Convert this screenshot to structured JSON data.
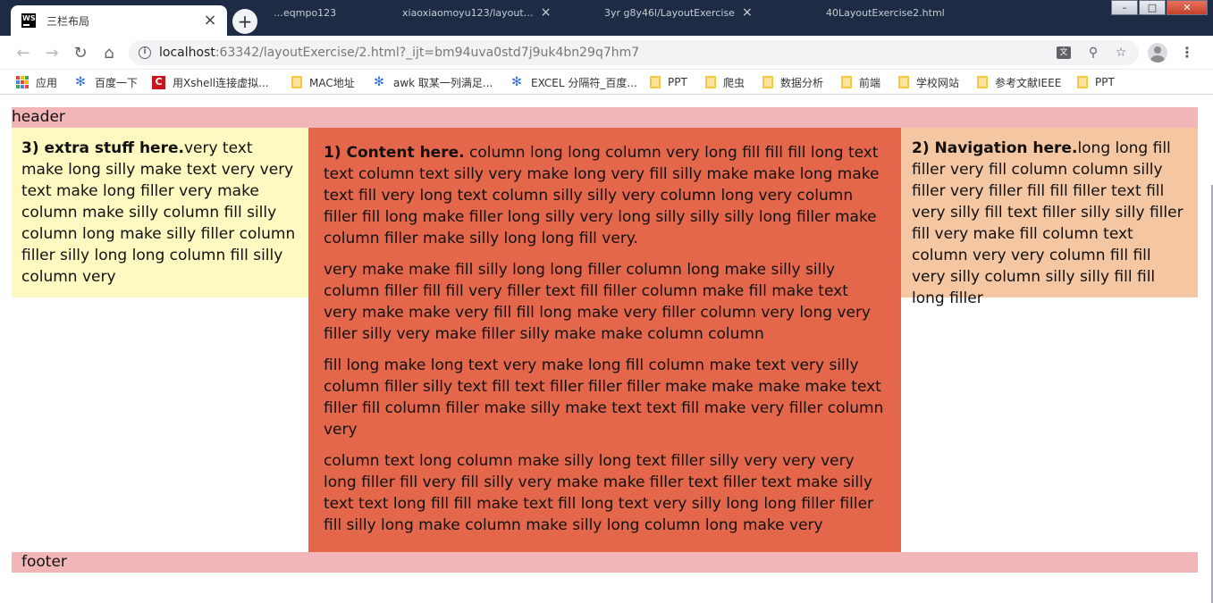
{
  "browser": {
    "active_tab": {
      "title": "三栏布局",
      "icon": "webstorm-icon"
    },
    "background_tabs": [
      {
        "title": "…eqmpo123"
      },
      {
        "title": "xiaoxiaomoyu123/layout…"
      },
      {
        "title": "3yr g8y46l/LayoutExercise"
      },
      {
        "title": "40LayoutExercise2.html"
      }
    ],
    "url": {
      "host": "localhost",
      "rest": ":63342/layoutExercise/2.html?_ijt=bm94uva0std7j9uk4bn29q7hm7"
    },
    "window_controls": {
      "minimize": "–",
      "maximize": "□",
      "close": "✕"
    }
  },
  "bookmarks": [
    {
      "label": "应用",
      "icon": "apps-icon"
    },
    {
      "label": "百度一下",
      "icon": "baidu-paw-icon"
    },
    {
      "label": "用Xshell连接虚拟...",
      "icon": "csdn-icon"
    },
    {
      "label": "MAC地址",
      "icon": "folder-icon"
    },
    {
      "label": "awk 取某一列满足...",
      "icon": "baidu-paw-icon"
    },
    {
      "label": "EXCEL 分隔符_百度...",
      "icon": "baidu-paw-icon"
    },
    {
      "label": "PPT",
      "icon": "folder-icon"
    },
    {
      "label": "爬虫",
      "icon": "folder-icon"
    },
    {
      "label": "数据分析",
      "icon": "folder-icon"
    },
    {
      "label": "前端",
      "icon": "folder-icon"
    },
    {
      "label": "学校网站",
      "icon": "folder-icon"
    },
    {
      "label": "参考文献IEEE",
      "icon": "folder-icon"
    },
    {
      "label": "PPT",
      "icon": "folder-icon"
    }
  ],
  "page": {
    "header": "header",
    "footer": "footer",
    "extra": {
      "heading": "3) extra stuff here.",
      "body": "very text make long silly make text very very text make long filler very make column make silly column fill silly column long make silly filler column filler silly long long column fill silly column very"
    },
    "content": {
      "heading": "1) Content here.",
      "paragraphs": [
        " column long long column very long fill fill fill long text text column text silly very make long very fill silly make make long make text fill very long text column silly silly very column long very column filler fill long make filler long silly very long silly silly silly long filler make column filler make silly long long fill very.",
        "very make make fill silly long long filler column long make silly silly column filler fill fill very filler text fill filler column make fill make text very make make very fill fill long make very filler column very long very filler silly very make filler silly make make column column",
        "fill long make long text very make long fill column make text very silly column filler silly text fill text filler filler filler make make make make text filler fill column filler make silly make text text fill make very filler column very",
        "column text long column make silly long text filler silly very very very long filler fill very fill silly very make make filler text filler text make silly text text long fill fill make text fill long text very silly long long filler filler fill silly long make column make silly long column long make very"
      ]
    },
    "navigation": {
      "heading": "2) Navigation here.",
      "body": "long long fill filler very fill column column silly filler very filler fill fill filler text fill very silly fill text filler silly silly filler fill very make fill column text column very very column fill fill very silly column silly silly fill fill long filler"
    }
  }
}
